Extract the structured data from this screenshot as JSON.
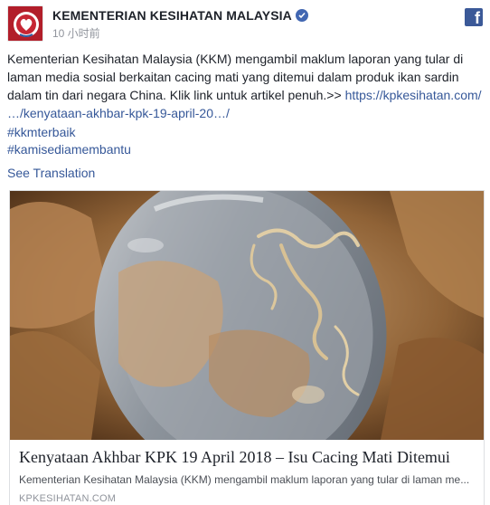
{
  "post": {
    "page_name": "KEMENTERIAN KESIHATAN MALAYSIA",
    "timestamp": "10 小时前",
    "body_text": "Kementerian Kesihatan Malaysia (KKM) mengambil maklum laporan yang tular di laman media sosial berkaitan cacing mati yang ditemui dalam produk ikan sardin dalam tin dari negara China. Klik link untuk artikel penuh.>> ",
    "body_link_1": "https://kpkesihatan.com/",
    "body_link_2": "…/kenyataan-akhbar-kpk-19-april-20…/",
    "hashtags": [
      "#kkmterbaik",
      "#kamisediamembantu"
    ],
    "see_translation": "See Translation"
  },
  "attachment": {
    "title": "Kenyataan Akhbar KPK 19 April 2018 – Isu Cacing Mati Ditemui",
    "description": "Kementerian Kesihatan Malaysia (KKM) mengambil maklum laporan yang tular di laman me...",
    "domain": "KPKESIHATAN.COM"
  },
  "icons": {
    "verified": "verified-badge-icon",
    "facebook": "facebook-logo-icon"
  },
  "colors": {
    "link": "#365899",
    "brand": "#3b5998",
    "avatar_red": "#b21e2a"
  }
}
